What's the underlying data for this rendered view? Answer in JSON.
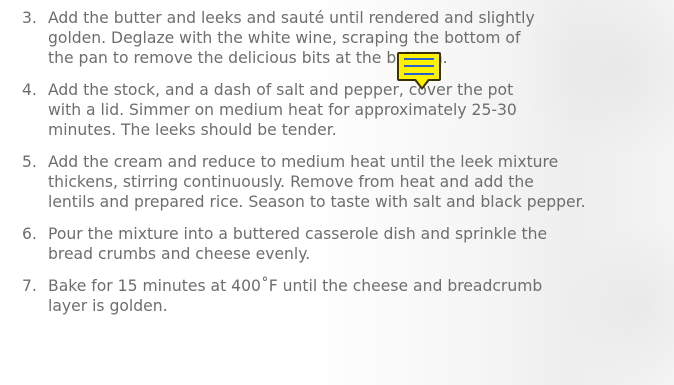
{
  "steps": [
    {
      "number": "3.",
      "text": "Add the butter and leeks and sauté until rendered and slightly\ngolden. Deglaze with the white wine, scraping the bottom of\nthe pan to remove the delicious bits at the bottom."
    },
    {
      "number": "4.",
      "text": "Add the stock, and a dash of salt and pepper, cover the pot\nwith a lid. Simmer on medium heat for approximately 25-30\nminutes. The leeks should be tender."
    },
    {
      "number": "5.",
      "text": "Add the cream and reduce to medium heat until the leek mixture\nthickens, stirring continuously. Remove from heat and add the\nlentils and prepared rice. Season to taste with salt and black pepper."
    },
    {
      "number": "6.",
      "text": "Pour the mixture into a buttered casserole dish and sprinkle the\nbread crumbs and cheese evenly."
    },
    {
      "number": "7.",
      "text": "Bake for 15 minutes at 400˚F until the cheese and breadcrumb\nlayer is golden."
    }
  ],
  "annotation": {
    "icon": "comment-note-icon",
    "color": "#fff200"
  }
}
